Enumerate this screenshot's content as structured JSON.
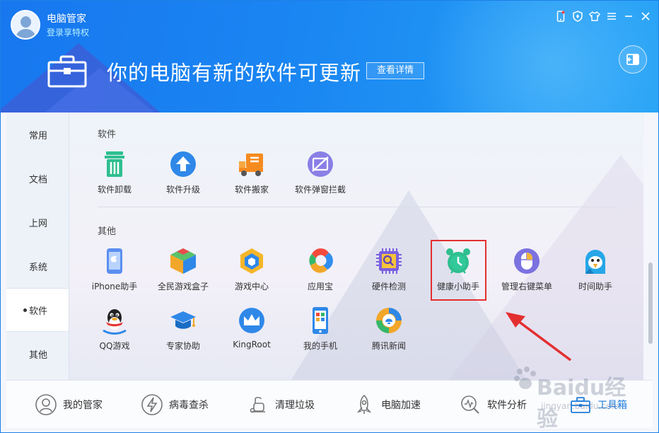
{
  "header": {
    "app_title": "电脑管家",
    "login_link": "登录享特权",
    "banner_title": "你的电脑有新的软件可更新",
    "detail_button": "查看详情"
  },
  "titlebar_icons": [
    "phone-icon",
    "shield-icon",
    "shirt-icon",
    "menu-icon",
    "minimize-icon",
    "close-icon"
  ],
  "sidebar": {
    "items": [
      {
        "label": "常用"
      },
      {
        "label": "文档"
      },
      {
        "label": "上网"
      },
      {
        "label": "系统"
      },
      {
        "label": "软件",
        "active": true
      },
      {
        "label": "其他"
      }
    ]
  },
  "sections": {
    "software_label": "软件",
    "other_label": "其他"
  },
  "software_tools": [
    {
      "label": "软件卸载",
      "icon": "trash-icon",
      "color": "#2fbf8f"
    },
    {
      "label": "软件升级",
      "icon": "upgrade-arrow-icon",
      "color": "#2f88e8"
    },
    {
      "label": "软件搬家",
      "icon": "truck-icon",
      "color": "#f58b1f"
    },
    {
      "label": "软件弹窗拦截",
      "icon": "block-popup-icon",
      "color": "#8a7fe6"
    }
  ],
  "other_tools_row1": [
    {
      "label": "iPhone助手",
      "icon": "iphone-icon",
      "color": "#5a8ff0"
    },
    {
      "label": "全民游戏盒子",
      "icon": "game-box-icon",
      "color": "#f2a72a"
    },
    {
      "label": "游戏中心",
      "icon": "game-center-icon",
      "color": "#f6b62a"
    },
    {
      "label": "应用宝",
      "icon": "app-store-icon",
      "color": "#2f8ef0"
    },
    {
      "label": "硬件检测",
      "icon": "chip-icon",
      "color": "#7a5fe0"
    },
    {
      "label": "健康小助手",
      "icon": "alarm-clock-icon",
      "color": "#2fbf8f"
    },
    {
      "label": "管理右键菜单",
      "icon": "mouse-icon",
      "color": "#7b72e0"
    },
    {
      "label": "时间助手",
      "icon": "parrot-icon",
      "color": "#26a6e8"
    }
  ],
  "other_tools_row2": [
    {
      "label": "QQ游戏",
      "icon": "qq-penguin-icon",
      "color": "#222222"
    },
    {
      "label": "专家协助",
      "icon": "graduation-cap-icon",
      "color": "#2f88e8"
    },
    {
      "label": "KingRoot",
      "icon": "crown-icon",
      "color": "#2f88e8"
    },
    {
      "label": "我的手机",
      "icon": "mobile-phone-icon",
      "color": "#2f88e8"
    },
    {
      "label": "腾讯新闻",
      "icon": "news-icon",
      "color": "#f2a72a"
    }
  ],
  "bottombar": {
    "items": [
      {
        "label": "我的管家",
        "icon": "butler-icon"
      },
      {
        "label": "病毒查杀",
        "icon": "lightning-icon"
      },
      {
        "label": "清理垃圾",
        "icon": "vacuum-icon"
      },
      {
        "label": "电脑加速",
        "icon": "rocket-icon"
      },
      {
        "label": "软件分析",
        "icon": "analysis-icon"
      },
      {
        "label": "工具箱",
        "icon": "toolbox-icon",
        "active": true
      }
    ]
  },
  "watermark": {
    "brand": "Baidu经验",
    "url": "jingyan.baidu.com"
  },
  "colors": {
    "accent": "#1a86f2",
    "highlight": "#e32f2f",
    "active_tab": "#1f7cdc"
  }
}
